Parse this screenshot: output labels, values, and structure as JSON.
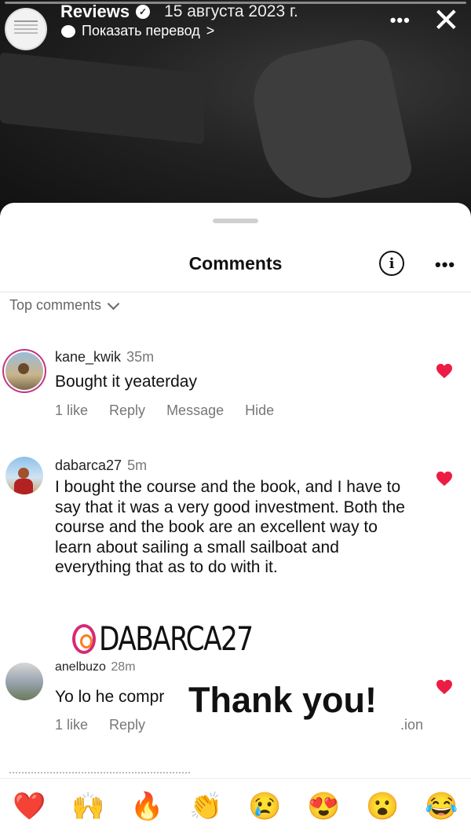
{
  "story": {
    "account_name": "Reviews",
    "date": "15 августа 2023 г.",
    "translate_label": "Показать перевод",
    "translate_chevron": ">"
  },
  "sheet": {
    "title": "Comments",
    "sort_label": "Top comments"
  },
  "comments": [
    {
      "username": "kane_kwik",
      "time": "35m",
      "text": "Bought it yeaterday",
      "actions": [
        "1 like",
        "Reply",
        "Message",
        "Hide"
      ]
    },
    {
      "username": "dabarca27",
      "time": "5m",
      "text": "I bought the course and the book, and I have to say that it was a very good investment. Both the course and the book are an excellent way to learn about sailing a small sailboat and everything that as to do with it.",
      "actions": []
    },
    {
      "username": "anelbuzo",
      "time": "28m",
      "text": "Yo lo he compr",
      "actions": [
        "1 like",
        "Reply"
      ],
      "trailing_text": ".ion"
    }
  ],
  "overlay": {
    "handle_tag": "DABARCA27",
    "thanks_text": "Thank you!"
  },
  "emoji_bar": [
    "❤️",
    "🙌",
    "🔥",
    "👏",
    "😢",
    "😍",
    "😮",
    "😂"
  ],
  "colors": {
    "heart": "#ed1c45",
    "story_ring": "#c13584"
  }
}
